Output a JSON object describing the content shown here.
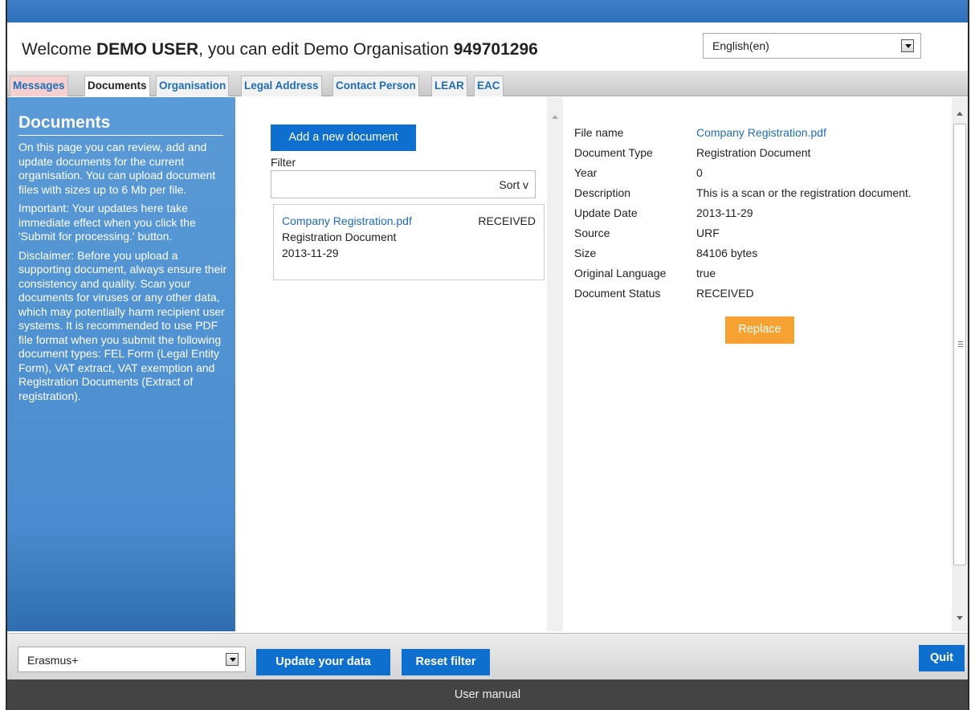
{
  "header": {
    "welcome_prefix": "Welcome ",
    "user_name": "DEMO USER",
    "welcome_mid": ", you can edit Demo Organisation ",
    "org_id": "949701296",
    "language": "English(en)"
  },
  "tabs": [
    {
      "label": "Messages"
    },
    {
      "label": "Documents"
    },
    {
      "label": "Organisation"
    },
    {
      "label": "Legal Address"
    },
    {
      "label": "Contact Person"
    },
    {
      "label": "LEAR"
    },
    {
      "label": "EAC"
    }
  ],
  "sidebar": {
    "title": "Documents",
    "paragraphs": [
      "On this page you can review, add and update documents for the current organisation. You can upload document files with sizes up to 6 Mb per file.",
      "Important: Your updates here take immediate effect when you click the 'Submit for processing.' button.",
      "Disclaimer: Before you upload a supporting document, always ensure their consistency and quality. Scan your documents for viruses or any other data, which may potentially harm recipient user systems. It is recommended to use PDF file format when you submit the following document types: FEL Form (Legal Entity Form), VAT extract, VAT exemption and Registration Documents (Extract of registration)."
    ]
  },
  "list": {
    "add_button": "Add a new document",
    "filter_label": "Filter",
    "filter_value": "",
    "sort_label": "Sort v",
    "documents": [
      {
        "name": "Company Registration.pdf",
        "status": "RECEIVED",
        "type": "Registration Document",
        "date": "2013-11-29"
      }
    ]
  },
  "detail": {
    "rows": [
      {
        "label": "File name",
        "value": "Company Registration.pdf"
      },
      {
        "label": "Document Type",
        "value": "Registration Document"
      },
      {
        "label": "Year",
        "value": "0"
      },
      {
        "label": "Description",
        "value": "This is a scan or the registration document."
      },
      {
        "label": "Update Date",
        "value": "2013-11-29"
      },
      {
        "label": "Source",
        "value": "URF"
      },
      {
        "label": "Size",
        "value": "84106 bytes"
      },
      {
        "label": "Original Language",
        "value": "true"
      },
      {
        "label": "Document Status",
        "value": "RECEIVED"
      }
    ],
    "replace_button": "Replace"
  },
  "bottom": {
    "program": "Erasmus+",
    "update_button": "Update your data",
    "reset_button": "Reset filter",
    "quit_button": "Quit"
  },
  "footer": {
    "link": "User manual"
  },
  "colors": {
    "accent_blue": "#0e6fce",
    "sidebar_blue": "#4a8ccf",
    "replace_orange": "#f5a233",
    "link_blue": "#1f6cb8",
    "messages_tab_bg": "#f6d0d0"
  }
}
